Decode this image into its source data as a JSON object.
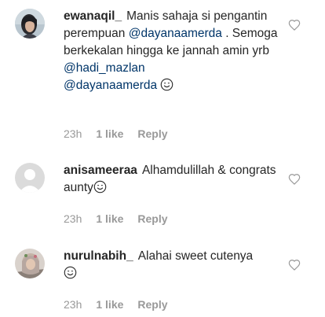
{
  "comments": [
    {
      "username": "ewanaqil_",
      "text_1": "Manis sahaja si pengantin perempuan ",
      "mention_1": "@dayanaamerda",
      "text_2": " . Semoga berkekalan hingga ke jannah amin yrb ",
      "mention_2": "@hadi_mazlan",
      "mention_3": "@dayanaamerda",
      "emoji": "smiling-face-emoji",
      "time": "23h",
      "likes": "1 like",
      "reply": "Reply",
      "avatar": "user-photo-dark-hair"
    },
    {
      "username": "anisameeraa",
      "text_1": "Alhamdulillah & congrats aunty",
      "emoji": "smiling-face-emoji",
      "time": "23h",
      "likes": "1 like",
      "reply": "Reply",
      "avatar": "default-user-silhouette"
    },
    {
      "username": "nurulnabih_",
      "text_1": "Alahai sweet cutenya",
      "emoji": "smiling-face-emoji",
      "time": "23h",
      "likes": "1 like",
      "reply": "Reply",
      "avatar": "user-photo-hijab"
    }
  ],
  "icons": {
    "like": "heart-outline-icon"
  },
  "colors": {
    "text": "#262626",
    "mention": "#003569",
    "meta": "#999999"
  }
}
